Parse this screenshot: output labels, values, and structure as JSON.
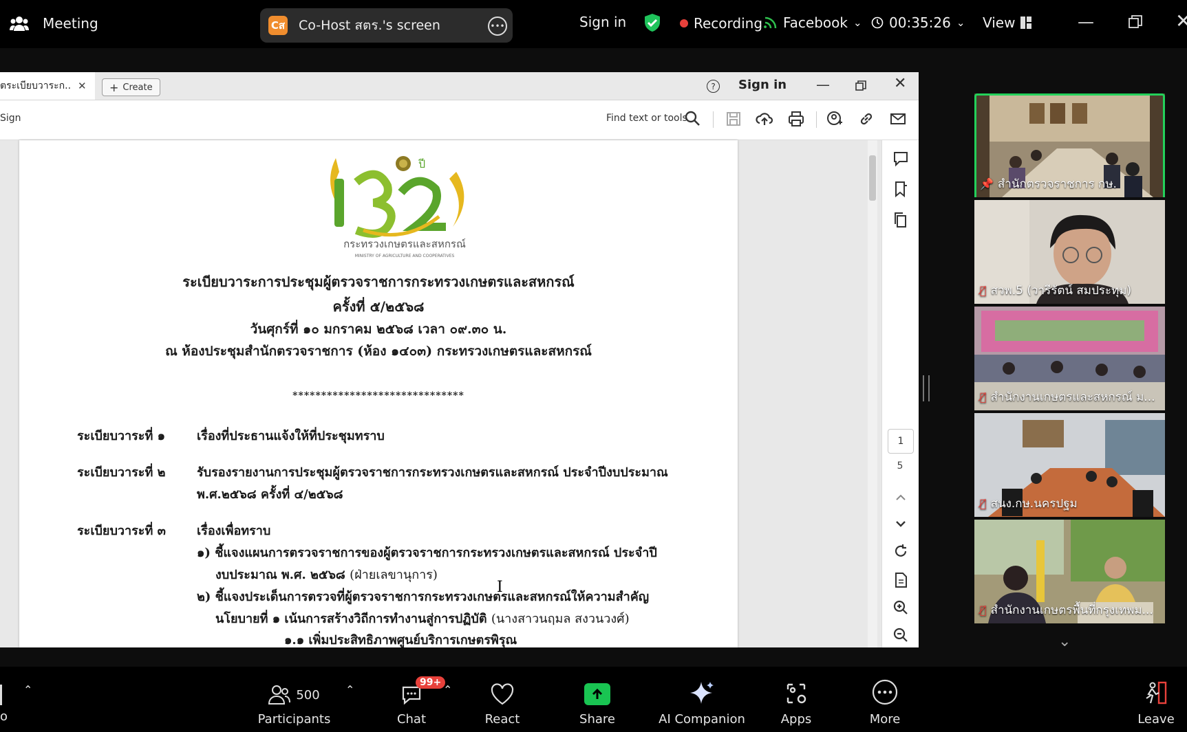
{
  "topbar": {
    "meeting_label": "Meeting",
    "screen_avatar": "Cส",
    "screen_label": "Co-Host สตร.'s screen",
    "sign_in": "Sign in",
    "recording": "Recording",
    "facebook": "Facebook",
    "timer": "00:35:26",
    "view": "View",
    "colors": {
      "recording": "#e8413b",
      "shield": "#1fc35b",
      "live": "#2fbf4e"
    }
  },
  "acrobat": {
    "tab_label": "ตระเบียบวาระก..",
    "create_label": "Create",
    "sign_in": "Sign in",
    "sign_label": "Sign",
    "find_label": "Find text or tools",
    "page_current": "1",
    "page_total": "5"
  },
  "document": {
    "logo_text": "กระทรวงเกษตรและสหกรณ์",
    "logo_subtext": "MINISTRY OF AGRICULTURE AND COOPERATIVES",
    "title": "ระเบียบวาระการประชุมผู้ตรวจราชการกระทรวงเกษตรและสหกรณ์",
    "session": "ครั้งที่ ๕/๒๕๖๘",
    "date": "วันศุกร์ที่ ๑๐ มกราคม ๒๕๖๘ เวลา ๐๙.๓๐ น.",
    "venue": "ณ ห้องประชุมสำนักตรวจราชการ (ห้อง ๑๔๐๓) กระทรวงเกษตรและสหกรณ์",
    "stars": "******************************",
    "agenda": [
      {
        "label": "ระเบียบวาระที่ ๑",
        "text": "เรื่องที่ประธานแจ้งให้ที่ประชุมทราบ"
      },
      {
        "label": "ระเบียบวาระที่ ๒",
        "text": "รับรองรายงานการประชุมผู้ตรวจราชการกระทรวงเกษตรและสหกรณ์ ประจำปีงบประมาณ",
        "text2": "พ.ศ.๒๕๖๘ ครั้งที่ ๔/๒๕๖๘"
      },
      {
        "label": "ระเบียบวาระที่ ๓",
        "text": "เรื่องเพื่อทราบ"
      }
    ],
    "items": {
      "i1_a": "๑) ชี้แจงแผนการตรวจราชการของผู้ตรวจราชการกระทรวงเกษตรและสหกรณ์ ประจำปี",
      "i1_b": "งบประมาณ พ.ศ. ๒๕๖๘",
      "i1_c": "(ฝ่ายเลขานุการ)",
      "i2_a": "๒) ชี้แจงประเด็นการตรวจที่ผู้ตรวจราชการกระทรวงเกษตรและสหกรณ์ให้ความสำคัญ",
      "i2_b": "นโยบายที่ ๑ เน้นการสร้างวิถีการทำงานสู่การปฏิบัติ",
      "i2_c": "(นางสาวนฤมล  สงวนวงศ์)",
      "i2_d": "๑.๑ เพิ่มประสิทธิภาพศูนย์บริการเกษตรพิรุณ"
    }
  },
  "participants": [
    {
      "name": "สำนักตรวจราชการ กษ.",
      "pinned": true,
      "muted": false,
      "active": true
    },
    {
      "name": "สวพ.5 (วารีรัตน์ สมประทุม)",
      "muted": true
    },
    {
      "name": "สำนักงานเกษตรและสหกรณ์ ม...",
      "muted": true
    },
    {
      "name": "สนง.กษ.นครปฐม",
      "muted": true
    },
    {
      "name": "สำนักงานเกษตรพื้นที่กรุงเทพม...",
      "muted": true
    }
  ],
  "bottombar": {
    "participants_count": "500",
    "participants_label": "Participants",
    "chat_badge": "99+",
    "chat_label": "Chat",
    "react_label": "React",
    "share_label": "Share",
    "ai_label": "AI Companion",
    "apps_label": "Apps",
    "more_label": "More",
    "leave_label": "Leave",
    "left_partial": "o"
  }
}
